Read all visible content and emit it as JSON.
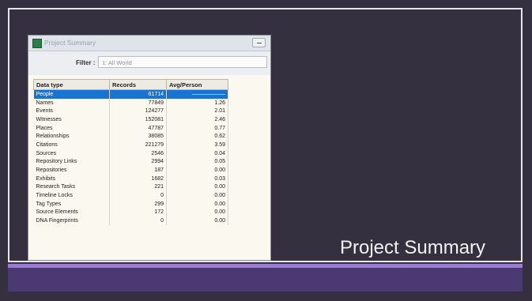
{
  "slide": {
    "title": "Project Summary"
  },
  "window": {
    "title": "Project Summary",
    "filter_label": "Filter :",
    "filter_value": "1: All World"
  },
  "table": {
    "columns": [
      "Data type",
      "Records",
      "Avg/Person"
    ],
    "rows": [
      {
        "type": "People",
        "records": "61714",
        "avg": "——————"
      },
      {
        "type": "Names",
        "records": "77849",
        "avg": "1.26"
      },
      {
        "type": "Events",
        "records": "124277",
        "avg": "2.01"
      },
      {
        "type": "Witnesses",
        "records": "152081",
        "avg": "2.46"
      },
      {
        "type": "Places",
        "records": "47787",
        "avg": "0.77"
      },
      {
        "type": "Relationships",
        "records": "38085",
        "avg": "0.62"
      },
      {
        "type": "Citations",
        "records": "221279",
        "avg": "3.59"
      },
      {
        "type": "Sources",
        "records": "2546",
        "avg": "0.04"
      },
      {
        "type": "Repository Links",
        "records": "2994",
        "avg": "0.05"
      },
      {
        "type": "Repositories",
        "records": "187",
        "avg": "0.00"
      },
      {
        "type": "Exhibits",
        "records": "1682",
        "avg": "0.03"
      },
      {
        "type": "Research Tasks",
        "records": "221",
        "avg": "0.00"
      },
      {
        "type": "Timeline Locks",
        "records": "0",
        "avg": "0.00"
      },
      {
        "type": "Tag Types",
        "records": "299",
        "avg": "0.00"
      },
      {
        "type": "Source Elements",
        "records": "172",
        "avg": "0.00"
      },
      {
        "type": "DNA Fingerprints",
        "records": "0",
        "avg": "0.00"
      }
    ]
  },
  "colors": {
    "selection": "#1a73d1",
    "slide_background": "#343040",
    "accent": "#9a7dd0"
  }
}
